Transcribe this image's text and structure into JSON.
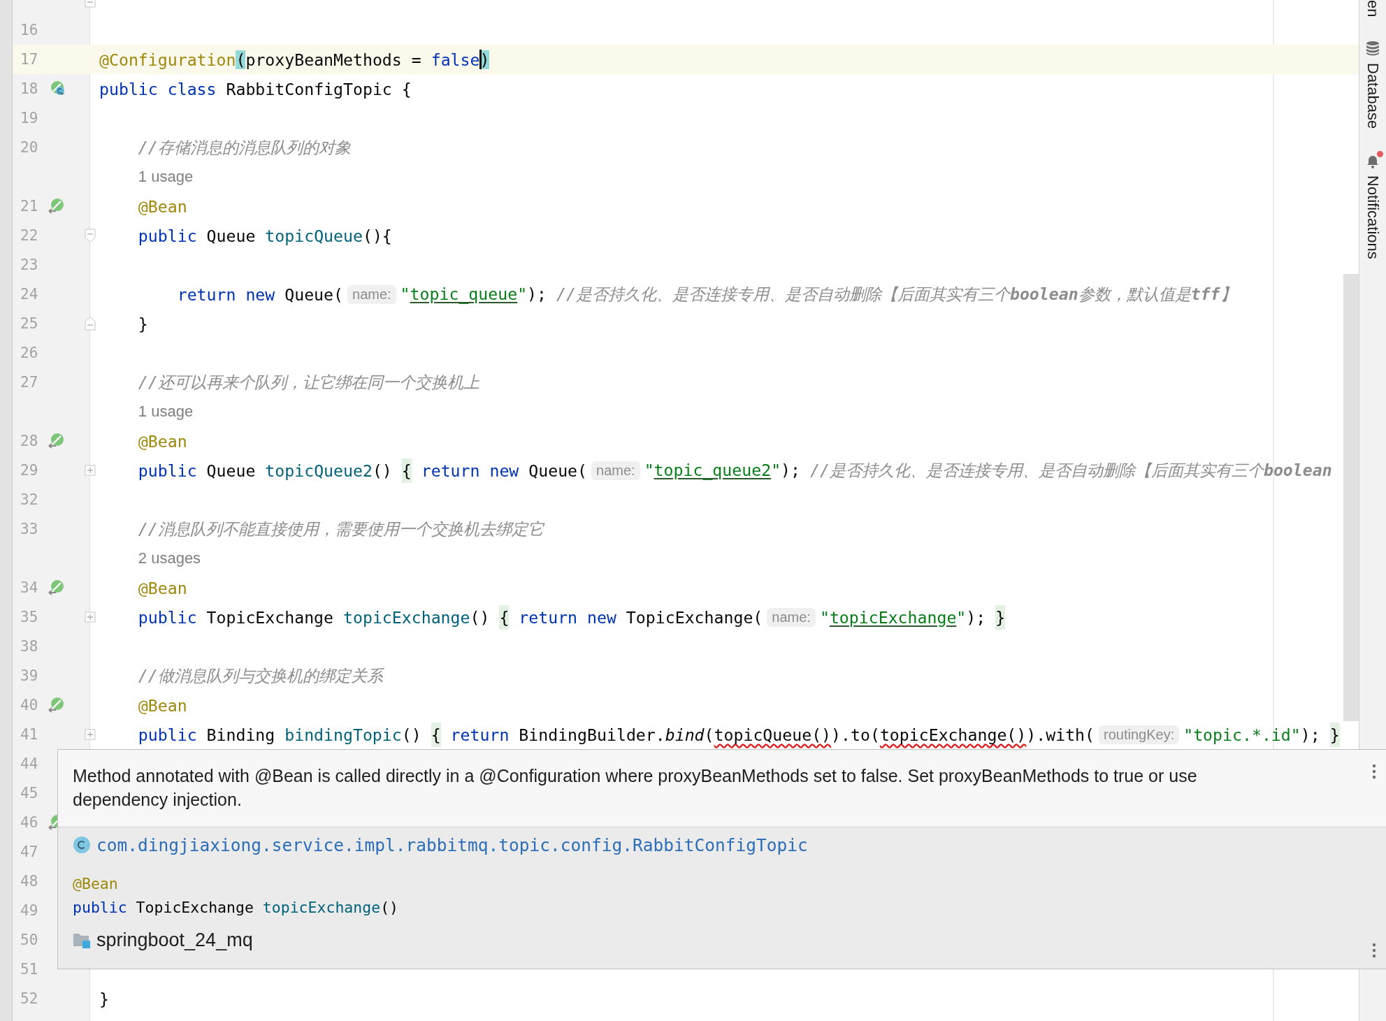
{
  "editor": {
    "lines": [
      {
        "current": false,
        "fold_marker": {
          "kind": "end"
        }
      },
      {
        "number": "16",
        "current": false
      },
      {
        "number": "17",
        "current": true,
        "tokens": [
          {
            "kind": "ann",
            "text": "@Configuration"
          },
          {
            "kind": "match",
            "text": "("
          },
          {
            "kind": "plain",
            "text": "proxyBeanMethods = "
          },
          {
            "kind": "kw",
            "text": "false"
          },
          {
            "kind": "caret"
          },
          {
            "kind": "match",
            "text": ")"
          }
        ]
      },
      {
        "number": "18",
        "current": false,
        "gutter_icon": {
          "kind": "bean-class"
        },
        "tokens": [
          {
            "kind": "kw",
            "text": "public class"
          },
          {
            "kind": "plain",
            "text": " RabbitConfigTopic {"
          }
        ],
        "children": [
          {
            "number": "19",
            "current": false
          },
          {
            "number": "20",
            "current": false,
            "tokens": [
              {
                "kind": "comment",
                "text": "//存储消息的消息队列的对象"
              }
            ]
          },
          {
            "current": false,
            "tokens": [
              {
                "kind": "usage",
                "text": "1 usage"
              }
            ]
          },
          {
            "number": "21",
            "current": false,
            "gutter_icon": {
              "kind": "bean"
            },
            "tokens": [
              {
                "kind": "ann",
                "text": "@Bean"
              }
            ]
          },
          {
            "number": "22",
            "current": false,
            "fold_marker": {
              "kind": "start"
            },
            "tokens": [
              {
                "kind": "kw",
                "text": "public"
              },
              {
                "kind": "plain",
                "text": " Queue "
              },
              {
                "kind": "method",
                "text": "topicQueue"
              },
              {
                "kind": "plain",
                "text": "(){"
              }
            ],
            "children": [
              {
                "number": "23",
                "current": false
              },
              {
                "number": "24",
                "current": false,
                "tokens": [
                  {
                    "kind": "kw",
                    "text": "return new"
                  },
                  {
                    "kind": "plain",
                    "text": " Queue("
                  },
                  {
                    "kind": "hint",
                    "text": "name:"
                  },
                  {
                    "kind": "str",
                    "text": "\""
                  },
                  {
                    "kind": "strlink",
                    "text": "topic_queue"
                  },
                  {
                    "kind": "str",
                    "text": "\""
                  },
                  {
                    "kind": "plain",
                    "text": "); "
                  },
                  {
                    "kind": "comment",
                    "text": "//是否持久化、是否连接专用、是否自动删除【后面其实有三个**boolean**参数，默认值是**tff**】"
                  }
                ]
              }
            ]
          },
          {
            "number": "25",
            "current": false,
            "fold_marker": {
              "kind": "end"
            },
            "tokens": [
              {
                "kind": "plain",
                "text": "}"
              }
            ]
          },
          {
            "number": "26",
            "current": false
          },
          {
            "number": "27",
            "current": false,
            "tokens": [
              {
                "kind": "comment",
                "text": "//还可以再来个队列，让它绑在同一个交换机上"
              }
            ]
          },
          {
            "current": false,
            "tokens": [
              {
                "kind": "usage",
                "text": "1 usage"
              }
            ]
          },
          {
            "number": "28",
            "current": false,
            "gutter_icon": {
              "kind": "bean"
            },
            "tokens": [
              {
                "kind": "ann",
                "text": "@Bean"
              }
            ]
          },
          {
            "number": "29",
            "current": false,
            "fold_marker": {
              "kind": "collapsed"
            },
            "tokens": [
              {
                "kind": "kw",
                "text": "public"
              },
              {
                "kind": "plain",
                "text": " Queue "
              },
              {
                "kind": "method",
                "text": "topicQueue2"
              },
              {
                "kind": "plain",
                "text": "() "
              },
              {
                "kind": "fold",
                "text": "{"
              },
              {
                "kind": "kw",
                "text": " return new"
              },
              {
                "kind": "plain",
                "text": " Queue("
              },
              {
                "kind": "hint",
                "text": "name:"
              },
              {
                "kind": "str",
                "text": "\""
              },
              {
                "kind": "strlink",
                "text": "topic_queue2"
              },
              {
                "kind": "str",
                "text": "\""
              },
              {
                "kind": "plain",
                "text": "); "
              },
              {
                "kind": "comment",
                "text": "//是否持久化、是否连接专用、是否自动删除【后面其实有三个**boolean**"
              }
            ]
          },
          {
            "number": "32",
            "current": false
          },
          {
            "number": "33",
            "current": false,
            "tokens": [
              {
                "kind": "comment",
                "text": "//消息队列不能直接使用，需要使用一个交换机去绑定它"
              }
            ]
          },
          {
            "current": false,
            "tokens": [
              {
                "kind": "usage",
                "text": "2 usages"
              }
            ]
          },
          {
            "number": "34",
            "current": false,
            "gutter_icon": {
              "kind": "bean"
            },
            "tokens": [
              {
                "kind": "ann",
                "text": "@Bean"
              }
            ]
          },
          {
            "number": "35",
            "current": false,
            "fold_marker": {
              "kind": "collapsed"
            },
            "tokens": [
              {
                "kind": "kw",
                "text": "public"
              },
              {
                "kind": "plain",
                "text": " TopicExchange "
              },
              {
                "kind": "method",
                "text": "topicExchange"
              },
              {
                "kind": "plain",
                "text": "() "
              },
              {
                "kind": "fold",
                "text": "{"
              },
              {
                "kind": "kw",
                "text": " return new"
              },
              {
                "kind": "plain",
                "text": " TopicExchange("
              },
              {
                "kind": "hint",
                "text": "name:"
              },
              {
                "kind": "str",
                "text": "\""
              },
              {
                "kind": "strlink",
                "text": "topicExchange"
              },
              {
                "kind": "str",
                "text": "\""
              },
              {
                "kind": "plain",
                "text": "); "
              },
              {
                "kind": "fold",
                "text": "}"
              }
            ]
          },
          {
            "number": "38",
            "current": false
          },
          {
            "number": "39",
            "current": false,
            "tokens": [
              {
                "kind": "comment",
                "text": "//做消息队列与交换机的绑定关系"
              }
            ]
          },
          {
            "number": "40",
            "current": false,
            "gutter_icon": {
              "kind": "bean"
            },
            "tokens": [
              {
                "kind": "ann",
                "text": "@Bean"
              }
            ]
          },
          {
            "number": "41",
            "current": false,
            "fold_marker": {
              "kind": "collapsed"
            },
            "tokens": [
              {
                "kind": "kw",
                "text": "public"
              },
              {
                "kind": "plain",
                "text": " Binding "
              },
              {
                "kind": "method",
                "text": "bindingTopic"
              },
              {
                "kind": "plain",
                "text": "() "
              },
              {
                "kind": "fold",
                "text": "{"
              },
              {
                "kind": "kw",
                "text": " return"
              },
              {
                "kind": "plain",
                "text": " BindingBuilder."
              },
              {
                "kind": "static",
                "text": "bind"
              },
              {
                "kind": "plain",
                "text": "("
              },
              {
                "kind": "err",
                "text": "topicQueue()"
              },
              {
                "kind": "plain",
                "text": ").to("
              },
              {
                "kind": "err",
                "text": "topicExchange()"
              },
              {
                "kind": "plain",
                "text": ").with("
              },
              {
                "kind": "hint",
                "text": "routingKey:"
              },
              {
                "kind": "str",
                "text": "\"topic.*.id\""
              },
              {
                "kind": "plain",
                "text": "); "
              },
              {
                "kind": "fold",
                "text": "}"
              }
            ]
          },
          {
            "number": "44"
          },
          {
            "number": "45"
          },
          {
            "number": "46",
            "gutter_icon": {
              "kind": "bean"
            }
          },
          {
            "number": "47"
          },
          {
            "number": "48"
          },
          {
            "number": "49"
          },
          {
            "number": "50"
          },
          {
            "number": "51",
            "current": false
          }
        ]
      },
      {
        "number": "52",
        "current": false,
        "tokens": [
          {
            "kind": "plain",
            "text": "}"
          }
        ]
      }
    ]
  },
  "popup": {
    "message": "Method annotated with @Bean is called directly in a @Configuration where proxyBeanMethods set to false. Set proxyBeanMethods to true or use dependency injection.",
    "class_name": "com.dingjiaxiong.service.impl.rabbitmq.topic.config.RabbitConfigTopic",
    "signature": [
      [
        {
          "kind": "ann",
          "text": "@Bean"
        }
      ],
      [
        {
          "kind": "kw",
          "text": "public"
        },
        {
          "kind": "plain",
          "text": " TopicExchange "
        },
        {
          "kind": "method",
          "text": "topicExchange"
        },
        {
          "kind": "plain",
          "text": "()"
        }
      ]
    ],
    "module": "springboot_24_mq"
  },
  "tool_windows": [
    {
      "label": "en",
      "unread": false
    },
    {
      "label": "Database",
      "icon": {
        "kind": "database"
      },
      "unread": false
    },
    {
      "label": "Notifications",
      "icon": {
        "kind": "bell"
      },
      "unread": true
    }
  ]
}
